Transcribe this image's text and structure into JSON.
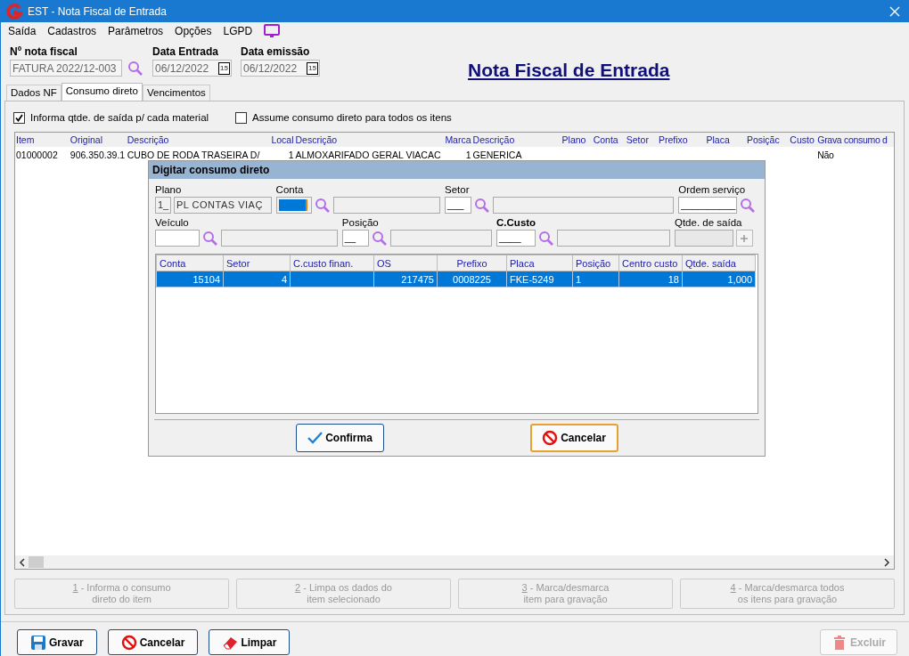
{
  "window": {
    "title": "EST - Nota Fiscal de Entrada"
  },
  "menu": [
    {
      "label": "Saída"
    },
    {
      "label": "Cadastros"
    },
    {
      "label": "Parâmetros"
    },
    {
      "label": "Opções"
    },
    {
      "label": "LGPD"
    }
  ],
  "header_fields": [
    {
      "label": "Nº nota fiscal",
      "value": "FATURA 2022/12-003",
      "kind": "lookup"
    },
    {
      "label": "Data Entrada",
      "value": "06/12/2022",
      "kind": "date",
      "calendar": "15"
    },
    {
      "label": "Data emissão",
      "value": "06/12/2022",
      "kind": "date",
      "calendar": "15"
    }
  ],
  "page_title": "Nota Fiscal de Entrada",
  "tabs": [
    {
      "label": "Dados NF",
      "selected": false
    },
    {
      "label": "Consumo direto",
      "selected": true
    },
    {
      "label": "Vencimentos",
      "selected": false
    }
  ],
  "options": [
    {
      "label": "Informa qtde. de saída p/ cada material",
      "checked": true
    },
    {
      "label": "Assume consumo direto para todos os itens",
      "checked": false
    }
  ],
  "items_table": {
    "columns": [
      "Item",
      "Original",
      "Descrição",
      "Local",
      "Descrição",
      "Marca",
      "Descrição",
      "Plano",
      "Conta",
      "Setor",
      "Prefixo",
      "Placa",
      "Posiçãc",
      "Custo",
      "Grava consumo d"
    ],
    "rows": [
      {
        "cells": [
          "01000002",
          "906.350.39.1",
          "CUBO DE RODA TRASEIRA D/",
          "1",
          "ALMOXARIFADO GERAL VIACAC",
          "1",
          "GENERICA",
          "",
          "",
          "",
          "",
          "",
          "",
          "",
          "Não"
        ]
      }
    ]
  },
  "action_buttons": [
    {
      "number": "1",
      "lines": [
        "- Informa o consumo",
        "direto do item"
      ],
      "disabled": true
    },
    {
      "number": "2",
      "lines": [
        "- Limpa os dados do",
        "item selecionado"
      ],
      "disabled": true
    },
    {
      "number": "3",
      "lines": [
        "- Marca/desmarca",
        "item para gravação"
      ],
      "disabled": true
    },
    {
      "number": "4",
      "lines": [
        "- Marca/desmarca todos",
        "os itens para gravação"
      ],
      "disabled": true
    }
  ],
  "footer_buttons": [
    {
      "label": "Gravar",
      "kind": "save",
      "disabled": false
    },
    {
      "label": "Cancelar",
      "kind": "cancel",
      "disabled": false
    },
    {
      "label": "Limpar",
      "kind": "eraser",
      "disabled": false
    },
    {
      "label": "Excluir",
      "kind": "trash",
      "disabled": true
    }
  ],
  "dialog": {
    "title": "Digitar consumo direto",
    "field_rows": [
      [
        {
          "label": "Plano",
          "kind": "readonly",
          "code": "1_",
          "value": "PL CONTAS  VIAÇ"
        },
        {
          "label": "Conta",
          "kind": "lookup",
          "focused": true
        },
        {
          "label": "Setor",
          "kind": "lookup",
          "value": "___"
        },
        {
          "label": "Ordem serviço",
          "kind": "search",
          "value": "__________"
        }
      ],
      [
        {
          "label": "Veículo",
          "kind": "lookup"
        },
        {
          "label": "Posição",
          "kind": "lookup",
          "value": "__"
        },
        {
          "label": "C.Custo",
          "kind": "lookup",
          "value": "____",
          "bold": true
        },
        {
          "label": "Qtde. de saída",
          "kind": "qty",
          "disabled": true
        }
      ]
    ],
    "table": {
      "columns": [
        "Conta",
        "Setor",
        "C.custo finan.",
        "OS",
        "Prefixo",
        "Placa",
        "Posição",
        "Centro custo",
        "Qtde. saída"
      ],
      "rows": [
        {
          "cells": [
            "15104",
            "4",
            "",
            "217475",
            "0008225",
            "FKE-5249",
            "1",
            "18",
            "1,000"
          ],
          "selected": true
        }
      ]
    },
    "buttons": [
      {
        "label": "Confirma",
        "kind": "check",
        "focused": false
      },
      {
        "label": "Cancelar",
        "kind": "cancel",
        "focused": true
      }
    ]
  }
}
